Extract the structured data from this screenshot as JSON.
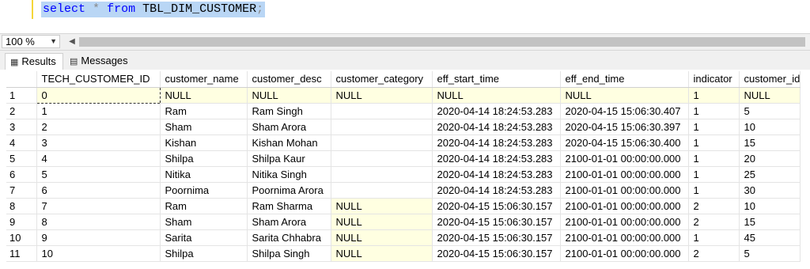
{
  "editor": {
    "kw_select": "select",
    "star": "*",
    "kw_from": "from",
    "table_name": "TBL_DIM_CUSTOMER",
    "semicolon": ";"
  },
  "zoom": {
    "value": "100 %"
  },
  "tabs": [
    {
      "label": "Results",
      "icon": "grid-icon"
    },
    {
      "label": "Messages",
      "icon": "messages-icon"
    }
  ],
  "colors": {
    "null_cell": "#ffffe1",
    "keyword": "#0000ff",
    "selection": "#b9d6f5"
  },
  "grid": {
    "columns": [
      "TECH_CUSTOMER_ID",
      "customer_name",
      "customer_desc",
      "customer_category",
      "eff_start_time",
      "eff_end_time",
      "indicator",
      "customer_id"
    ],
    "rows": [
      [
        "1",
        "0",
        "NULL",
        "NULL",
        "NULL",
        "NULL",
        "NULL",
        "1",
        "NULL"
      ],
      [
        "2",
        "1",
        "Ram",
        "Ram Singh",
        "",
        "2020-04-14 18:24:53.283",
        "2020-04-15 15:06:30.407",
        "1",
        "5"
      ],
      [
        "3",
        "2",
        "Sham",
        "Sham Arora",
        "",
        "2020-04-14 18:24:53.283",
        "2020-04-15 15:06:30.397",
        "1",
        "10"
      ],
      [
        "4",
        "3",
        "Kishan",
        "Kishan Mohan",
        "",
        "2020-04-14 18:24:53.283",
        "2020-04-15 15:06:30.400",
        "1",
        "15"
      ],
      [
        "5",
        "4",
        "Shilpa",
        "Shilpa Kaur",
        "",
        "2020-04-14 18:24:53.283",
        "2100-01-01 00:00:00.000",
        "1",
        "20"
      ],
      [
        "6",
        "5",
        "Nitika",
        "Nitika Singh",
        "",
        "2020-04-14 18:24:53.283",
        "2100-01-01 00:00:00.000",
        "1",
        "25"
      ],
      [
        "7",
        "6",
        "Poornima",
        "Poornima Arora",
        "",
        "2020-04-14 18:24:53.283",
        "2100-01-01 00:00:00.000",
        "1",
        "30"
      ],
      [
        "8",
        "7",
        "Ram",
        "Ram Sharma",
        "NULL",
        "2020-04-15 15:06:30.157",
        "2100-01-01 00:00:00.000",
        "2",
        "10"
      ],
      [
        "9",
        "8",
        "Sham",
        "Sham Arora",
        "NULL",
        "2020-04-15 15:06:30.157",
        "2100-01-01 00:00:00.000",
        "2",
        "15"
      ],
      [
        "10",
        "9",
        "Sarita",
        "Sarita Chhabra",
        "NULL",
        "2020-04-15 15:06:30.157",
        "2100-01-01 00:00:00.000",
        "1",
        "45"
      ],
      [
        "11",
        "10",
        "Shilpa",
        "Shilpa Singh",
        "NULL",
        "2020-04-15 15:06:30.157",
        "2100-01-01 00:00:00.000",
        "2",
        "5"
      ]
    ]
  }
}
